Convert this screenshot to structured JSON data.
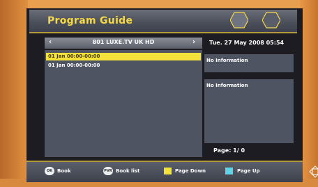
{
  "header": {
    "title": "Program Guide"
  },
  "channel": {
    "name": "801 LUXE.TV UK HD",
    "prev_icon": "chevron-left-icon",
    "next_icon": "chevron-right-icon"
  },
  "datetime": "Tue.  27 May 2008 05:54",
  "events": [
    {
      "time": "01 Jan 00:00-00:00",
      "selected": true
    },
    {
      "time": "01 Jan 00:00-00:00",
      "selected": false
    }
  ],
  "info": {
    "short": "No Information",
    "detail": "No Information"
  },
  "pagination": {
    "text": "Page:  1/ 0"
  },
  "footer": {
    "ok_label": "OK",
    "book": "Book",
    "pvr_label": "PVR",
    "book_list": "Book list",
    "page_down": "Page Down",
    "page_up": "Page Up",
    "page_down_color": "#f2e23a",
    "page_up_color": "#5fd3e8"
  },
  "colors": {
    "accent": "#f5d84a",
    "selected_row": "#f2e23a",
    "panel": "#4e5462"
  }
}
